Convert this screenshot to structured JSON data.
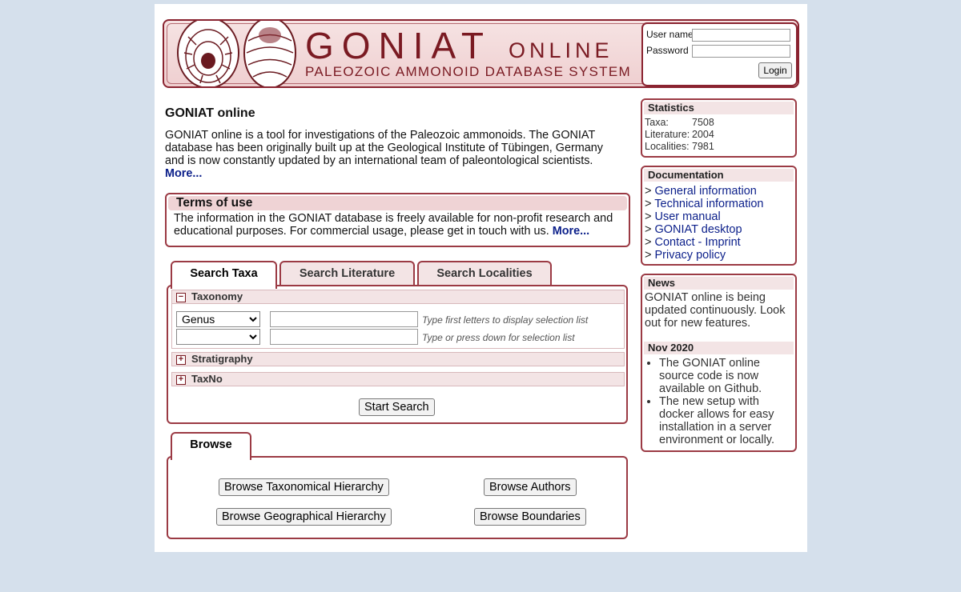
{
  "header": {
    "title": "GONIAT",
    "title_suffix": "ONLINE",
    "subtitle": "PALEOZOIC AMMONOID DATABASE SYSTEM"
  },
  "login": {
    "username_label": "User name",
    "password_label": "Password",
    "username_value": "",
    "password_value": "",
    "login_button": "Login"
  },
  "intro": {
    "title": "GONIAT online",
    "text": "GONIAT online is a tool for investigations of the Paleozoic ammonoids. The GONIAT database has been originally built up at the Geological Institute of Tübingen, Germany and is now constantly updated by an international team of paleontological scientists.",
    "more": "More..."
  },
  "terms": {
    "title": "Terms of use",
    "text": "The information in the GONIAT database is freely available for non-profit research and educational purposes. For commercial usage, please get in touch with us.",
    "more": "More..."
  },
  "search": {
    "tabs": [
      "Search Taxa",
      "Search Literature",
      "Search Localities"
    ],
    "active_tab": "Search Taxa",
    "taxonomy_label": "Taxonomy",
    "rank_selected": "Genus",
    "rank2_selected": "",
    "taxon_value": "",
    "taxon2_value": "",
    "hint1": "Type first letters to display selection list",
    "hint2": "Type or press down for selection list",
    "stratigraphy_label": "Stratigraphy",
    "taxno_label": "TaxNo",
    "start_button": "Start Search",
    "expand_symbol": "+",
    "collapse_symbol": "−"
  },
  "browse": {
    "tab": "Browse",
    "buttons": [
      "Browse Taxonomical Hierarchy",
      "Browse Authors",
      "Browse Geographical Hierarchy",
      "Browse Boundaries"
    ]
  },
  "statistics": {
    "title": "Statistics",
    "rows": [
      {
        "label": "Taxa:",
        "value": "7508"
      },
      {
        "label": "Literature:",
        "value": "2004"
      },
      {
        "label": "Localities:",
        "value": "7981"
      }
    ]
  },
  "documentation": {
    "title": "Documentation",
    "prefix": ">",
    "links": [
      "General information",
      "Technical information",
      "User manual",
      "GONIAT desktop",
      "Contact - Imprint",
      "Privacy policy"
    ]
  },
  "news": {
    "title": "News",
    "text": "GONIAT online is being updated continuously. Look out for new features.",
    "date_title": "Nov 2020",
    "items": [
      "The GONIAT online source code is now available on Github.",
      "The new setup with docker allows for easy installation in a server environment or locally."
    ]
  },
  "colors": {
    "accent": "#9b3a44",
    "banner_text": "#7a1a22",
    "link": "#0b1f8a",
    "background": "#d5e0ec"
  }
}
